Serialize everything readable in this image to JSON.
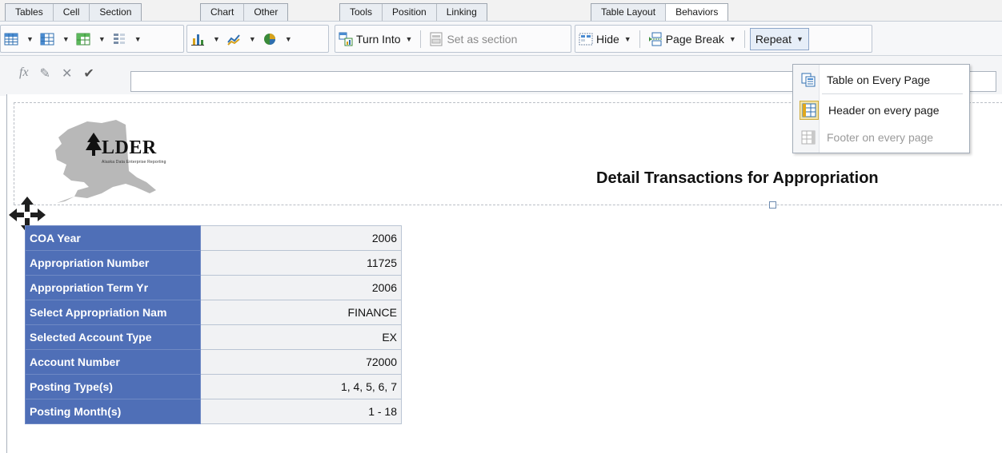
{
  "tabs": {
    "group1": [
      "Tables",
      "Cell",
      "Section"
    ],
    "group2": [
      "Chart",
      "Other"
    ],
    "group3": [
      "Tools",
      "Position",
      "Linking"
    ],
    "group4": [
      "Table Layout",
      "Behaviors"
    ]
  },
  "toolbar": {
    "turn_into": "Turn Into",
    "set_as_section": "Set as section",
    "hide": "Hide",
    "page_break": "Page Break",
    "repeat": "Repeat"
  },
  "formula_bar": {
    "fx_label": "fx",
    "value": ""
  },
  "repeat_menu": {
    "items": [
      {
        "label": "Table on Every Page",
        "enabled": true
      },
      {
        "label": "Header on every page",
        "enabled": true
      },
      {
        "label": "Footer on every page",
        "enabled": false
      }
    ]
  },
  "report": {
    "logo_text": "LDER",
    "logo_subtitle": "Alaska Data Enterprise Reporting",
    "title": "Detail Transactions for Appropriation"
  },
  "detail_table": [
    {
      "label": "COA Year",
      "value": "2006"
    },
    {
      "label": "Appropriation Number",
      "value": "11725"
    },
    {
      "label": "Appropriation Term Yr",
      "value": "2006"
    },
    {
      "label": "Select Appropriation Nam",
      "value": "FINANCE"
    },
    {
      "label": "Selected Account Type",
      "value": "EX"
    },
    {
      "label": "Account Number",
      "value": "72000"
    },
    {
      "label": "Posting Type(s)",
      "value": "1, 4, 5, 6, 7"
    },
    {
      "label": "Posting Month(s)",
      "value": "1 - 18"
    }
  ],
  "colors": {
    "table_label_bg": "#4f6fb7",
    "table_value_bg": "#f1f2f4",
    "accent": "#8da6c8"
  }
}
